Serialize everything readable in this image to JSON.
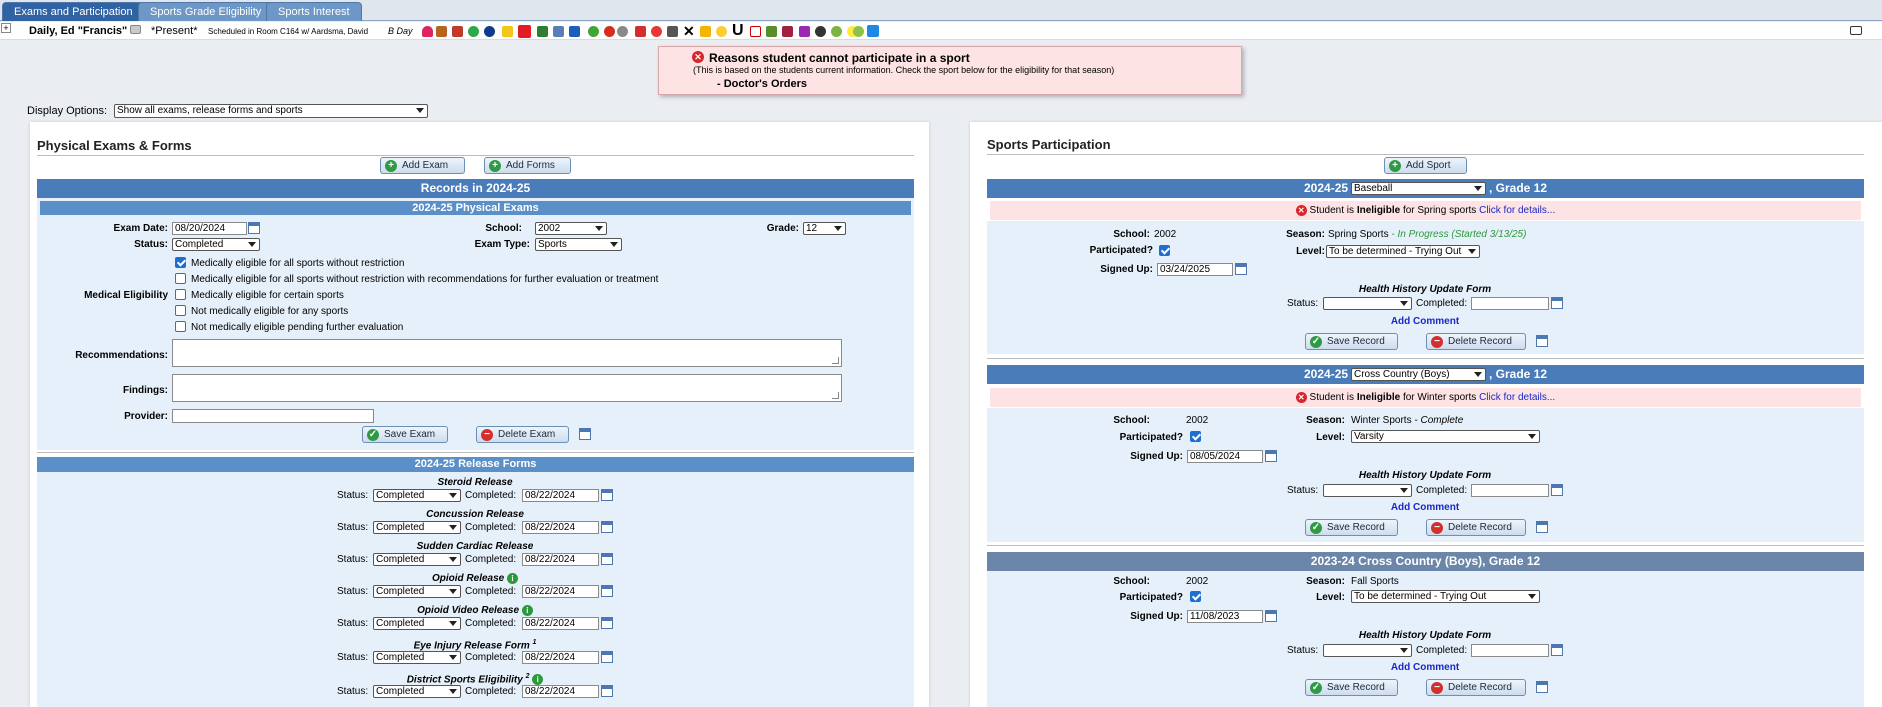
{
  "tabs": [
    "Exams and Participation",
    "Sports Grade Eligibility",
    "Sports Interest"
  ],
  "student": {
    "name": "Daily, Ed \"Francis\"",
    "status": "*Present*",
    "schedule": "Scheduled in Room C164 w/ Aardsma, David",
    "day": "B Day"
  },
  "alert": {
    "title": "Reasons student cannot participate in a sport",
    "note": "(This is based on the students current information. Check the sport below for the eligibility for that season)",
    "reason": "- Doctor's Orders"
  },
  "display_options": {
    "label": "Display Options:",
    "value": "Show all exams, release forms and sports"
  },
  "exams": {
    "heading": "Physical Exams & Forms",
    "add_exam": "Add Exam",
    "add_forms": "Add Forms",
    "records_title": "Records in 2024-25",
    "physical_title": "2024-25 Physical Exams",
    "exam_date_label": "Exam Date:",
    "exam_date": "08/20/2024",
    "school_label": "School:",
    "school": "2002",
    "grade_label": "Grade:",
    "grade": "12",
    "status_label": "Status:",
    "status": "Completed",
    "exam_type_label": "Exam Type:",
    "exam_type": "Sports",
    "med_elig_label": "Medical Eligibility",
    "elig_options": [
      "Medically eligible for all sports without restriction",
      "Medically eligible for all sports without restriction with recommendations for further evaluation or treatment",
      "Medically eligible for certain sports",
      "Not medically eligible for any sports",
      "Not medically eligible pending further evaluation"
    ],
    "recommendations_label": "Recommendations:",
    "findings_label": "Findings:",
    "provider_label": "Provider:",
    "save": "Save Exam",
    "delete": "Delete Exam"
  },
  "release": {
    "title": "2024-25 Release Forms",
    "status_label": "Status:",
    "completed_label": "Completed:",
    "forms": [
      {
        "name": "Steroid Release",
        "sup": "",
        "status": "Completed",
        "completed": "08/22/2024"
      },
      {
        "name": "Concussion Release",
        "sup": "",
        "status": "Completed",
        "completed": "08/22/2024"
      },
      {
        "name": "Sudden Cardiac Release",
        "sup": "",
        "status": "Completed",
        "completed": "08/22/2024"
      },
      {
        "name": "Opioid Release",
        "sup": "",
        "status": "Completed",
        "completed": "08/22/2024"
      },
      {
        "name": "Opioid Video Release",
        "sup": "",
        "status": "Completed",
        "completed": "08/22/2024"
      },
      {
        "name": "Eye Injury Release Form",
        "sup": "1",
        "status": "Completed",
        "completed": "08/22/2024"
      },
      {
        "name": "District Sports Eligibility",
        "sup": "2",
        "status": "Completed",
        "completed": "08/22/2024"
      }
    ]
  },
  "sports": {
    "heading": "Sports Participation",
    "add_sport": "Add Sport",
    "labels": {
      "school": "School:",
      "participated": "Participated?",
      "signed_up": "Signed Up:",
      "season": "Season:",
      "level": "Level:",
      "hhuf": "Health History Update Form",
      "status": "Status:",
      "completed": "Completed:",
      "add_comment": "Add Comment",
      "save": "Save Record",
      "delete": "Delete Record",
      "grade_suffix": ", Grade 12"
    },
    "records": [
      {
        "year": "2024-25",
        "sport": "Baseball",
        "inelig_prefix": "Student is",
        "inelig_word": "Ineligible",
        "inelig_suffix": "for Spring sports",
        "details": "Click for details...",
        "school": "2002",
        "season": "Spring Sports",
        "season_status": "- In Progress (Started 3/13/25)",
        "level": "To be determined - Trying Out",
        "signed_up": "03/24/2025"
      },
      {
        "year": "2024-25",
        "sport": "Cross Country (Boys)",
        "inelig_prefix": "Student is",
        "inelig_word": "Ineligible",
        "inelig_suffix": "for Winter sports",
        "details": "Click for details...",
        "school": "2002",
        "season": "Winter Sports",
        "season_status": "- Complete",
        "level": "Varsity",
        "signed_up": "08/05/2024"
      },
      {
        "title": "2023-24 Cross Country (Boys), Grade 12",
        "school": "2002",
        "season": "Fall Sports",
        "level": "To be determined - Trying Out",
        "signed_up": "11/08/2023"
      }
    ]
  }
}
